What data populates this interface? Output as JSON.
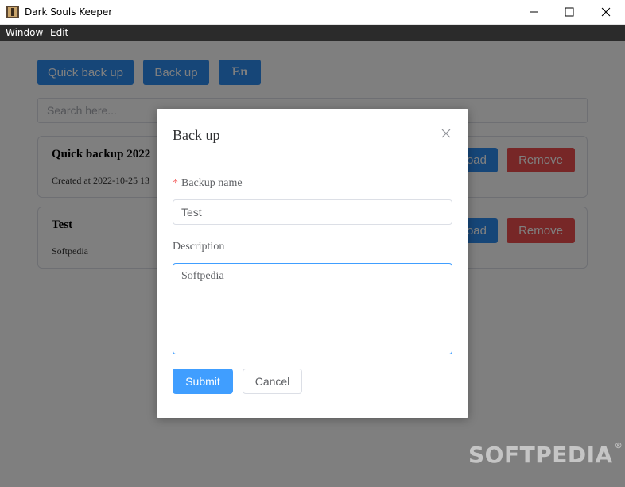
{
  "window": {
    "title": "Dark Souls Keeper"
  },
  "menu": {
    "items": [
      "Window",
      "Edit"
    ]
  },
  "toolbar": {
    "quick_backup": "Quick back up",
    "backup": "Back up",
    "lang": "En"
  },
  "search": {
    "placeholder": "Search here..."
  },
  "backups": [
    {
      "title": "Quick backup 2022",
      "subtitle": "Created at 2022-10-25 13",
      "load": "oad",
      "remove": "Remove"
    },
    {
      "title": "Test",
      "subtitle": "Softpedia",
      "load": "oad",
      "remove": "Remove"
    }
  ],
  "dialog": {
    "title": "Back up",
    "name_label": "Backup name",
    "name_required_mark": "*",
    "name_value": "Test",
    "desc_label": "Description",
    "desc_value": "Softpedia",
    "submit": "Submit",
    "cancel": "Cancel"
  },
  "watermark": {
    "text": "SOFTPEDIA",
    "mark": "®"
  },
  "colors": {
    "primary": "#2c8cf0",
    "danger": "#ef4f4f",
    "accent": "#409eff"
  }
}
